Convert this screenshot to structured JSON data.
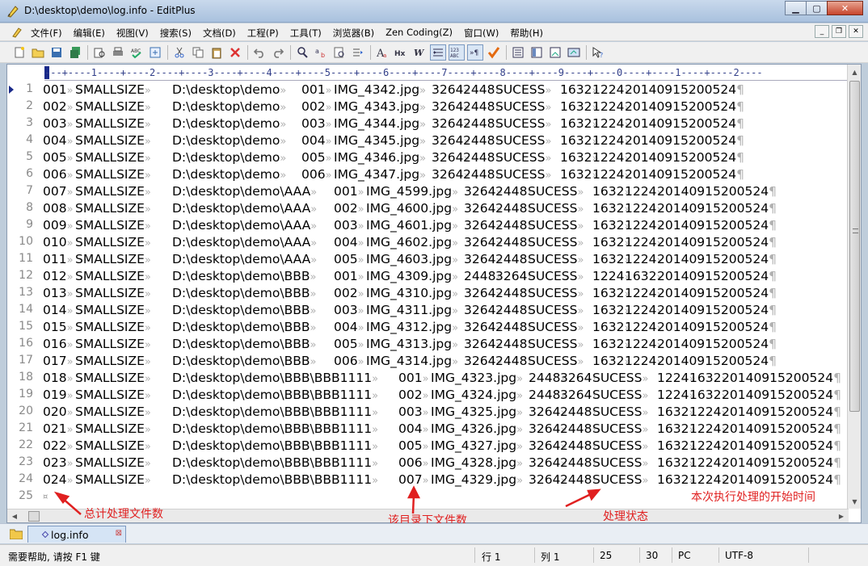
{
  "window": {
    "title": "D:\\desktop\\demo\\log.info - EditPlus"
  },
  "menu": [
    "文件(F)",
    "编辑(E)",
    "视图(V)",
    "搜索(S)",
    "文档(D)",
    "工程(P)",
    "工具(T)",
    "浏览器(B)",
    "Zen Coding(Z)",
    "窗口(W)",
    "帮助(H)"
  ],
  "ruler": "---+----1----+----2----+----3----+----4----+----5----+----6----+----7----+----8----+----9----+----0----+----1----+----2----",
  "line_numbers": [
    "1",
    "2",
    "3",
    "4",
    "5",
    "6",
    "7",
    "8",
    "9",
    "10",
    "11",
    "12",
    "13",
    "14",
    "15",
    "16",
    "17",
    "18",
    "19",
    "20",
    "21",
    "22",
    "23",
    "24",
    "25"
  ],
  "rows": [
    [
      "001",
      "SMALLSIZE",
      "D:\\desktop\\demo",
      "001",
      "IMG_4342.jpg",
      "3264",
      "2448",
      "SUCESS",
      "1632",
      "1224",
      "20140915200524"
    ],
    [
      "002",
      "SMALLSIZE",
      "D:\\desktop\\demo",
      "002",
      "IMG_4343.jpg",
      "3264",
      "2448",
      "SUCESS",
      "1632",
      "1224",
      "20140915200524"
    ],
    [
      "003",
      "SMALLSIZE",
      "D:\\desktop\\demo",
      "003",
      "IMG_4344.jpg",
      "3264",
      "2448",
      "SUCESS",
      "1632",
      "1224",
      "20140915200524"
    ],
    [
      "004",
      "SMALLSIZE",
      "D:\\desktop\\demo",
      "004",
      "IMG_4345.jpg",
      "3264",
      "2448",
      "SUCESS",
      "1632",
      "1224",
      "20140915200524"
    ],
    [
      "005",
      "SMALLSIZE",
      "D:\\desktop\\demo",
      "005",
      "IMG_4346.jpg",
      "3264",
      "2448",
      "SUCESS",
      "1632",
      "1224",
      "20140915200524"
    ],
    [
      "006",
      "SMALLSIZE",
      "D:\\desktop\\demo",
      "006",
      "IMG_4347.jpg",
      "3264",
      "2448",
      "SUCESS",
      "1632",
      "1224",
      "20140915200524"
    ],
    [
      "007",
      "SMALLSIZE",
      "D:\\desktop\\demo\\AAA",
      "001",
      "IMG_4599.jpg",
      "3264",
      "2448",
      "SUCESS",
      "1632",
      "1224",
      "20140915200524"
    ],
    [
      "008",
      "SMALLSIZE",
      "D:\\desktop\\demo\\AAA",
      "002",
      "IMG_4600.jpg",
      "3264",
      "2448",
      "SUCESS",
      "1632",
      "1224",
      "20140915200524"
    ],
    [
      "009",
      "SMALLSIZE",
      "D:\\desktop\\demo\\AAA",
      "003",
      "IMG_4601.jpg",
      "3264",
      "2448",
      "SUCESS",
      "1632",
      "1224",
      "20140915200524"
    ],
    [
      "010",
      "SMALLSIZE",
      "D:\\desktop\\demo\\AAA",
      "004",
      "IMG_4602.jpg",
      "3264",
      "2448",
      "SUCESS",
      "1632",
      "1224",
      "20140915200524"
    ],
    [
      "011",
      "SMALLSIZE",
      "D:\\desktop\\demo\\AAA",
      "005",
      "IMG_4603.jpg",
      "3264",
      "2448",
      "SUCESS",
      "1632",
      "1224",
      "20140915200524"
    ],
    [
      "012",
      "SMALLSIZE",
      "D:\\desktop\\demo\\BBB",
      "001",
      "IMG_4309.jpg",
      "2448",
      "3264",
      "SUCESS",
      "1224",
      "1632",
      "20140915200524"
    ],
    [
      "013",
      "SMALLSIZE",
      "D:\\desktop\\demo\\BBB",
      "002",
      "IMG_4310.jpg",
      "3264",
      "2448",
      "SUCESS",
      "1632",
      "1224",
      "20140915200524"
    ],
    [
      "014",
      "SMALLSIZE",
      "D:\\desktop\\demo\\BBB",
      "003",
      "IMG_4311.jpg",
      "3264",
      "2448",
      "SUCESS",
      "1632",
      "1224",
      "20140915200524"
    ],
    [
      "015",
      "SMALLSIZE",
      "D:\\desktop\\demo\\BBB",
      "004",
      "IMG_4312.jpg",
      "3264",
      "2448",
      "SUCESS",
      "1632",
      "1224",
      "20140915200524"
    ],
    [
      "016",
      "SMALLSIZE",
      "D:\\desktop\\demo\\BBB",
      "005",
      "IMG_4313.jpg",
      "3264",
      "2448",
      "SUCESS",
      "1632",
      "1224",
      "20140915200524"
    ],
    [
      "017",
      "SMALLSIZE",
      "D:\\desktop\\demo\\BBB",
      "006",
      "IMG_4314.jpg",
      "3264",
      "2448",
      "SUCESS",
      "1632",
      "1224",
      "20140915200524"
    ],
    [
      "018",
      "SMALLSIZE",
      "D:\\desktop\\demo\\BBB\\BBB1111",
      "001",
      "IMG_4323.jpg",
      "2448",
      "3264",
      "SUCESS",
      "1224",
      "1632",
      "20140915200524"
    ],
    [
      "019",
      "SMALLSIZE",
      "D:\\desktop\\demo\\BBB\\BBB1111",
      "002",
      "IMG_4324.jpg",
      "2448",
      "3264",
      "SUCESS",
      "1224",
      "1632",
      "20140915200524"
    ],
    [
      "020",
      "SMALLSIZE",
      "D:\\desktop\\demo\\BBB\\BBB1111",
      "003",
      "IMG_4325.jpg",
      "3264",
      "2448",
      "SUCESS",
      "1632",
      "1224",
      "20140915200524"
    ],
    [
      "021",
      "SMALLSIZE",
      "D:\\desktop\\demo\\BBB\\BBB1111",
      "004",
      "IMG_4326.jpg",
      "3264",
      "2448",
      "SUCESS",
      "1632",
      "1224",
      "20140915200524"
    ],
    [
      "022",
      "SMALLSIZE",
      "D:\\desktop\\demo\\BBB\\BBB1111",
      "005",
      "IMG_4327.jpg",
      "3264",
      "2448",
      "SUCESS",
      "1632",
      "1224",
      "20140915200524"
    ],
    [
      "023",
      "SMALLSIZE",
      "D:\\desktop\\demo\\BBB\\BBB1111",
      "006",
      "IMG_4328.jpg",
      "3264",
      "2448",
      "SUCESS",
      "1632",
      "1224",
      "20140915200524"
    ],
    [
      "024",
      "SMALLSIZE",
      "D:\\desktop\\demo\\BBB\\BBB1111",
      "007",
      "IMG_4329.jpg",
      "3264",
      "2448",
      "SUCESS",
      "1632",
      "1224",
      "20140915200524"
    ]
  ],
  "eof_marker": "¤",
  "annotations": {
    "total": "总计处理文件数",
    "dir_count": "该目录下文件数",
    "status": "处理状态",
    "start_time": "本次执行处理的开始时间"
  },
  "doc_tab": {
    "label": "log.info"
  },
  "statusbar": {
    "help": "需要帮助, 请按 F1 键",
    "row": "行 1",
    "col": "列 1",
    "lines": "25",
    "width": "30",
    "mode": "PC",
    "encoding": "UTF-8"
  }
}
